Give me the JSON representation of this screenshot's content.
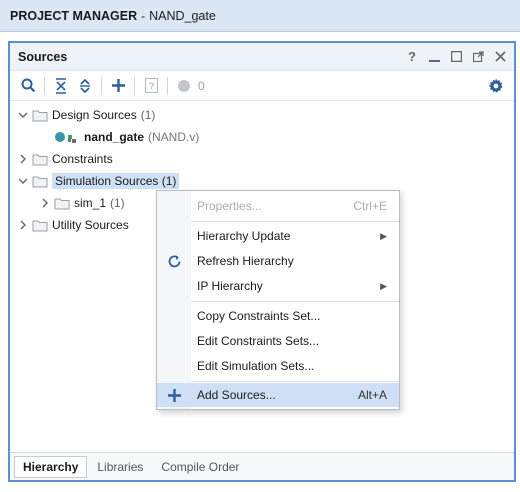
{
  "title_bar": {
    "section": "PROJECT MANAGER",
    "separator": "-",
    "project": "NAND_gate"
  },
  "panel": {
    "title": "Sources",
    "head_icons": [
      "help-icon",
      "minimize-icon",
      "maximize-icon",
      "float-icon",
      "close-icon"
    ],
    "help_glyph": "?",
    "toolbar": {
      "status_count": "0"
    }
  },
  "tree": {
    "design_sources": {
      "label": "Design Sources",
      "count": "(1)"
    },
    "nand_gate": {
      "label": "nand_gate",
      "file": "(NAND.v)"
    },
    "constraints": {
      "label": "Constraints"
    },
    "simulation_sources": {
      "label": "Simulation Sources (1)"
    },
    "sim_1": {
      "label": "sim_1",
      "count": "(1)"
    },
    "utility_sources": {
      "label": "Utility Sources"
    }
  },
  "context_menu": {
    "properties": {
      "label": "Properties...",
      "shortcut": "Ctrl+E"
    },
    "hierarchy_update": {
      "label": "Hierarchy Update"
    },
    "refresh_hierarchy": {
      "label": "Refresh Hierarchy"
    },
    "ip_hierarchy": {
      "label": "IP Hierarchy"
    },
    "copy_constraints": {
      "label": "Copy Constraints Set..."
    },
    "edit_constraints": {
      "label": "Edit Constraints Sets..."
    },
    "edit_simulation": {
      "label": "Edit Simulation Sets..."
    },
    "add_sources": {
      "label": "Add Sources...",
      "shortcut": "Alt+A"
    }
  },
  "bottom_tabs": {
    "hierarchy": "Hierarchy",
    "libraries": "Libraries",
    "compile_order": "Compile Order"
  },
  "colors": {
    "accent": "#5b8fd1",
    "selection": "#cfe0f6",
    "title_bg": "#dbe7f5"
  }
}
